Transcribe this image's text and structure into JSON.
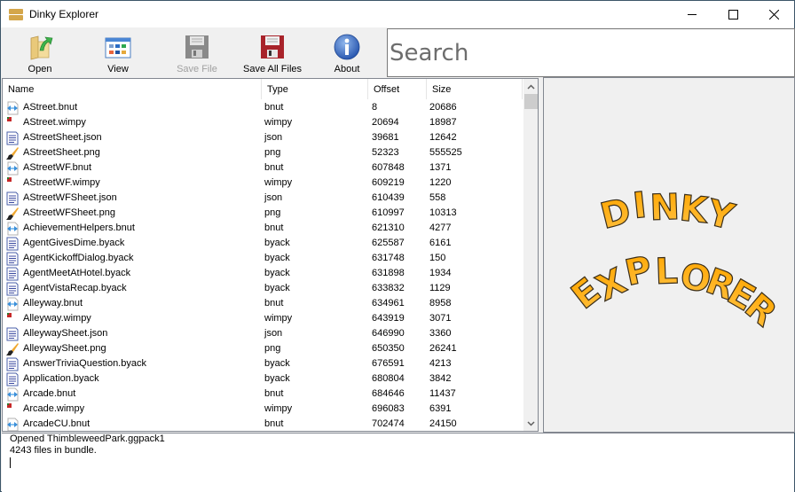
{
  "window": {
    "title": "Dinky Explorer",
    "controls": [
      "minimize",
      "maximize",
      "close"
    ]
  },
  "toolbar": {
    "buttons": [
      {
        "id": "open",
        "label": "Open",
        "icon": "open-folder-icon",
        "enabled": true
      },
      {
        "id": "view",
        "label": "View",
        "icon": "view-window-icon",
        "enabled": true
      },
      {
        "id": "save-file",
        "label": "Save File",
        "icon": "floppy-disk-icon",
        "enabled": false
      },
      {
        "id": "save-all",
        "label": "Save All Files",
        "icon": "floppy-disk-red-icon",
        "enabled": true
      },
      {
        "id": "about",
        "label": "About",
        "icon": "info-icon",
        "enabled": true
      }
    ]
  },
  "search": {
    "placeholder": "Search",
    "value": ""
  },
  "file_list": {
    "columns": [
      "Name",
      "Type",
      "Offset",
      "Size"
    ],
    "rows": [
      {
        "name": "AStreet.bnut",
        "type": "bnut",
        "offset": "8",
        "size": "20686"
      },
      {
        "name": "AStreet.wimpy",
        "type": "wimpy",
        "offset": "20694",
        "size": "18987"
      },
      {
        "name": "AStreetSheet.json",
        "type": "json",
        "offset": "39681",
        "size": "12642"
      },
      {
        "name": "AStreetSheet.png",
        "type": "png",
        "offset": "52323",
        "size": "555525"
      },
      {
        "name": "AStreetWF.bnut",
        "type": "bnut",
        "offset": "607848",
        "size": "1371"
      },
      {
        "name": "AStreetWF.wimpy",
        "type": "wimpy",
        "offset": "609219",
        "size": "1220"
      },
      {
        "name": "AStreetWFSheet.json",
        "type": "json",
        "offset": "610439",
        "size": "558"
      },
      {
        "name": "AStreetWFSheet.png",
        "type": "png",
        "offset": "610997",
        "size": "10313"
      },
      {
        "name": "AchievementHelpers.bnut",
        "type": "bnut",
        "offset": "621310",
        "size": "4277"
      },
      {
        "name": "AgentGivesDime.byack",
        "type": "byack",
        "offset": "625587",
        "size": "6161"
      },
      {
        "name": "AgentKickoffDialog.byack",
        "type": "byack",
        "offset": "631748",
        "size": "150"
      },
      {
        "name": "AgentMeetAtHotel.byack",
        "type": "byack",
        "offset": "631898",
        "size": "1934"
      },
      {
        "name": "AgentVistaRecap.byack",
        "type": "byack",
        "offset": "633832",
        "size": "1129"
      },
      {
        "name": "Alleyway.bnut",
        "type": "bnut",
        "offset": "634961",
        "size": "8958"
      },
      {
        "name": "Alleyway.wimpy",
        "type": "wimpy",
        "offset": "643919",
        "size": "3071"
      },
      {
        "name": "AlleywaySheet.json",
        "type": "json",
        "offset": "646990",
        "size": "3360"
      },
      {
        "name": "AlleywaySheet.png",
        "type": "png",
        "offset": "650350",
        "size": "26241"
      },
      {
        "name": "AnswerTriviaQuestion.byack",
        "type": "byack",
        "offset": "676591",
        "size": "4213"
      },
      {
        "name": "Application.byack",
        "type": "byack",
        "offset": "680804",
        "size": "3842"
      },
      {
        "name": "Arcade.bnut",
        "type": "bnut",
        "offset": "684646",
        "size": "11437"
      },
      {
        "name": "Arcade.wimpy",
        "type": "wimpy",
        "offset": "696083",
        "size": "6391"
      },
      {
        "name": "ArcadeCU.bnut",
        "type": "bnut",
        "offset": "702474",
        "size": "24150"
      }
    ]
  },
  "preview": {
    "logo_line1": "DINKY",
    "logo_line2": "EXPLORER",
    "logo_color": "#f5a623"
  },
  "log": {
    "lines": [
      "Opened ThimbleweedPark.ggpack1",
      "4243 files in bundle."
    ]
  }
}
